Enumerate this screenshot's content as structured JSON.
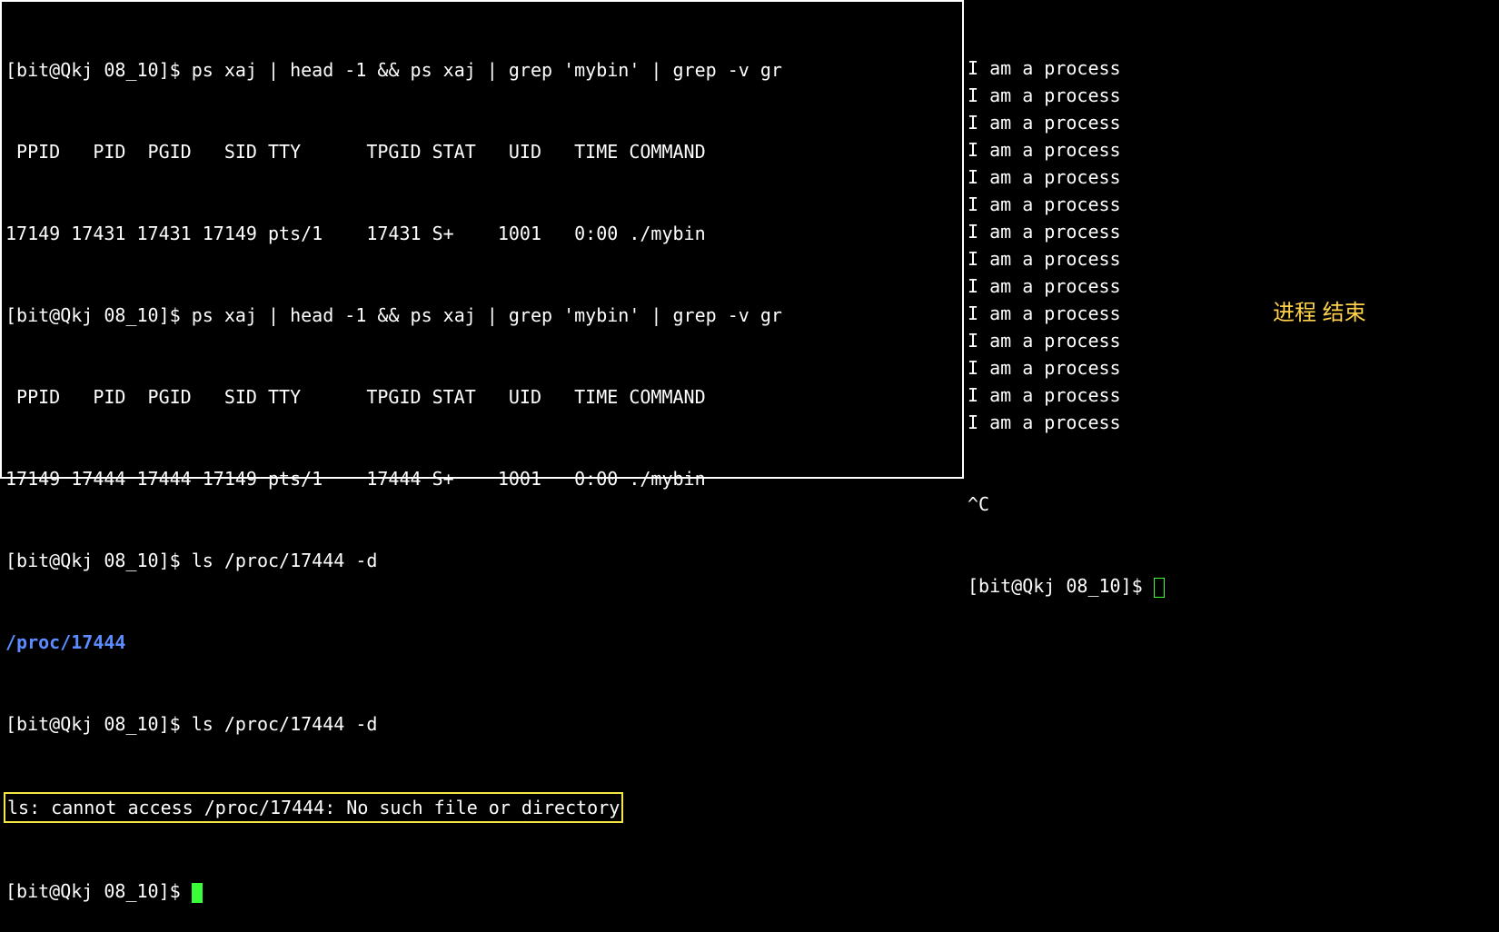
{
  "left": {
    "l1_prompt": "[bit@Qkj 08_10]$ ",
    "l1_cmd": "ps xaj | head -1 && ps xaj | grep 'mybin' | grep -v gr",
    "l2_header": " PPID   PID  PGID   SID TTY      TPGID STAT   UID   TIME COMMAND",
    "l3_row": "17149 17431 17431 17149 pts/1    17431 S+    1001   0:00 ./mybin",
    "l4_prompt": "[bit@Qkj 08_10]$ ",
    "l4_cmd": "ps xaj | head -1 && ps xaj | grep 'mybin' | grep -v gr",
    "l5_header": " PPID   PID  PGID   SID TTY      TPGID STAT   UID   TIME COMMAND",
    "l6_row": "17149 17444 17444 17149 pts/1    17444 S+    1001   0:00 ./mybin",
    "l7_prompt": "[bit@Qkj 08_10]$ ",
    "l7_cmd": "ls /proc/17444 -d",
    "l8_out": "/proc/17444",
    "l9_prompt": "[bit@Qkj 08_10]$ ",
    "l9_cmd": "ls /proc/17444 -d",
    "l10_err": "ls: cannot access /proc/17444: No such file or directory",
    "l11_prompt": "[bit@Qkj 08_10]$ "
  },
  "right": {
    "process_line": "I am a process",
    "process_count": 14,
    "interrupt": "^C",
    "prompt": "[bit@Qkj 08_10]$ ",
    "annotation": "进程 结束"
  }
}
